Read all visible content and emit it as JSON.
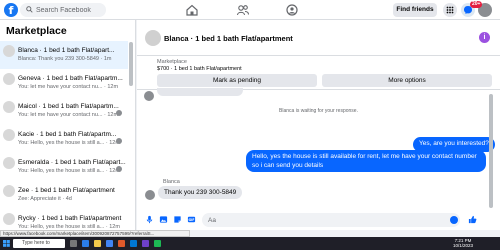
{
  "topbar": {
    "logo": "f",
    "search_placeholder": "Search Facebook",
    "find_friends": "Find friends",
    "notifications_badge": "20+"
  },
  "sidebar": {
    "title": "Marketplace",
    "conversations": [
      {
        "title": "Blanca · 1 bed 1 bath Flat/apart...",
        "subtitle": "Blanca: Thank you 239 300-5849 · 1m",
        "active": true
      },
      {
        "title": "Geneva · 1 bed 1 bath Flat/apartm...",
        "subtitle": "You: let me have your contact nu... · 12m",
        "active": false
      },
      {
        "title": "Maicol · 1 bed 1 bath Flat/apartm...",
        "subtitle": "You: let me have your contact nu... · 12m",
        "active": false
      },
      {
        "title": "Kacie · 1 bed 1 bath Flat/apartm...",
        "subtitle": "You: Hello, yes the house is still a... · 12m",
        "active": false
      },
      {
        "title": "Esmeralda · 1 bed 1 bath Flat/apart...",
        "subtitle": "You: Hello, yes the house is still a... · 12m",
        "active": false
      },
      {
        "title": "Zee · 1 bed 1 bath Flat/apartment",
        "subtitle": "Zee: Appreciate it · 4d",
        "active": false
      },
      {
        "title": "Rycky · 1 bed 1 bath Flat/apartment",
        "subtitle": "You: Hello, yes the house is still a... · 12m",
        "active": false
      }
    ]
  },
  "chat": {
    "header_title": "Blanca · 1 bed 1 bath Flat/apartment",
    "info_icon_text": "i",
    "marketplace_label": "Marketplace",
    "listing_price": "$700 · 1 bed 1 bath Flat/apartment",
    "mark_pending": "Mark as pending",
    "more_options": "More options",
    "waiting_text": "Blanca is waiting for your response.",
    "out_message_1": "Yes, are you interested?",
    "out_message_2": "Hello, yes the house is still available for rent, let me have your contact number so i can send you details",
    "sender_name": "Blanca",
    "in_message": "Thank  you 239 300-5849",
    "composer_placeholder": "Aa"
  },
  "statusbar": {
    "url": "https://www.facebook.com/marketplace/item/300920872757599/?referralS..."
  },
  "taskbar": {
    "search_placeholder": "Type here to search",
    "time": "7:21 PM",
    "date": "10/1/2023"
  },
  "colors": {
    "accent": "#0866ff",
    "sidebar_active": "#e7f3ff",
    "badge": "#e41e3f"
  }
}
